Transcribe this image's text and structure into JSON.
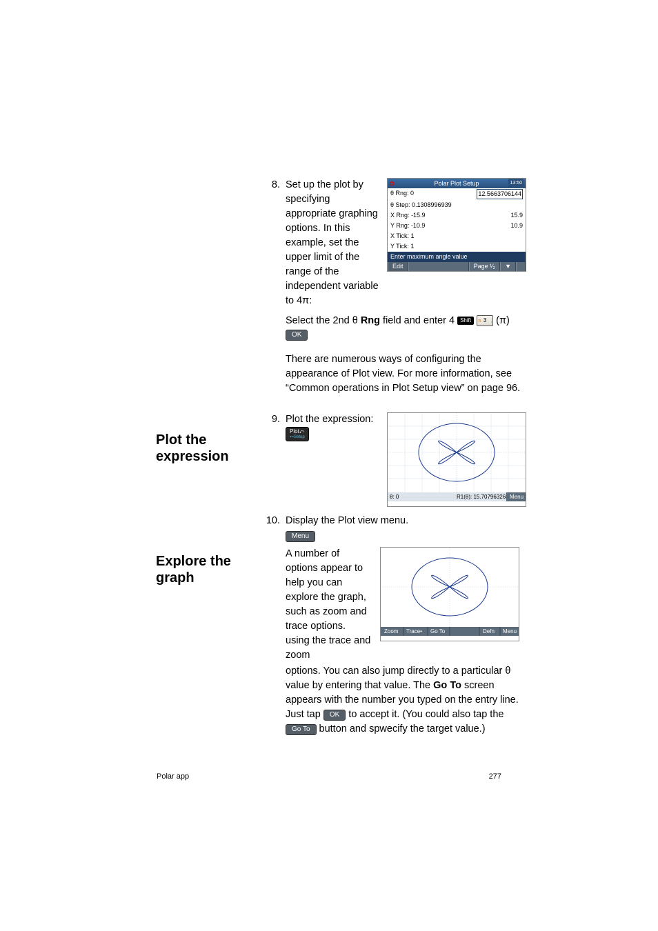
{
  "step8": {
    "num": "8.",
    "text1": "Set up the plot by specifying appropriate graphing options. In this example, set the upper limit of the range of the independent variable to 4π:",
    "select_line_a": "Select the 2nd θ ",
    "rng_bold": "Rng",
    "select_line_b": " field and enter 4",
    "shift": "Shift",
    "key3": "3",
    "pi_paren": " (π) ",
    "ok": "OK",
    "common_a": "There are numerous ways of configuring the appearance of Plot view. For more information, see “Common operations in Plot Setup view” on page 96."
  },
  "calc_setup": {
    "title": "Polar Plot Setup",
    "time": "13:50",
    "rows": [
      {
        "l": "θ Rng: 0",
        "r": "12.5663706144",
        "box": true
      },
      {
        "l": "θ Step: 0.1308996939",
        "r": ""
      },
      {
        "l": "X Rng: -15.9",
        "r": "15.9"
      },
      {
        "l": "Y Rng: -10.9",
        "r": "10.9"
      },
      {
        "l": "X Tick: 1",
        "r": ""
      },
      {
        "l": "Y Tick: 1",
        "r": ""
      }
    ],
    "hint": "Enter maximum angle value",
    "edit": "Edit",
    "page": "Page ¹⁄₂",
    "arrow": "▼"
  },
  "plot_heading": "Plot the expression",
  "step9": {
    "num": "9.",
    "text": "Plot the expression:",
    "plot_btn_top": "Plot",
    "plot_btn_sub": "⊷Setup",
    "status_l": "θ: 0",
    "status_r": "R1(θ): 15.707963268",
    "menu": "Menu"
  },
  "explore_heading": "Explore the graph",
  "step10": {
    "num": "10.",
    "text_lead": "Display the Plot view menu.",
    "menu_btn": "Menu",
    "para_a": "A number of options appear to help you can explore the graph, such as zoom and trace options. using the trace and zoom",
    "para_b_a": "options. You can also jump directly to a particular θ value by entering that value. The ",
    "goto_bold": "Go To",
    "para_b_b": " screen appears with the number you typed on the entry line. Just tap ",
    "ok": "OK",
    "para_b_c": " to accept it. (You could also tap the ",
    "goto_btn": "Go To",
    "para_b_d": " button and spwecify the target value.)",
    "bbar": [
      "Zoom",
      "Trace•",
      "Go To",
      "",
      "Defn",
      "Menu"
    ]
  },
  "footer": {
    "left": "Polar app",
    "right": "277"
  }
}
